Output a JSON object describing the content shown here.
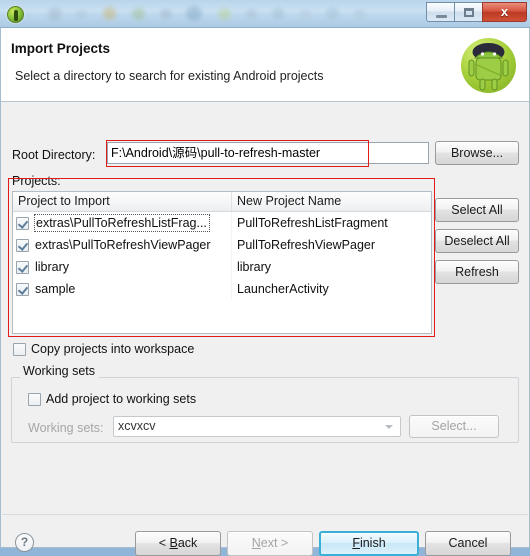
{
  "window": {
    "app_icon": "android-eclipse-icon",
    "controls": {
      "minimize_label": "",
      "maximize_label": "",
      "close_label": "x"
    }
  },
  "header": {
    "title": "Import Projects",
    "description": "Select a directory to search for existing Android projects",
    "logo": "android-robot-icon"
  },
  "root_directory": {
    "label": "Root Directory:",
    "value": "F:\\Android\\源码\\pull-to-refresh-master",
    "placeholder": "",
    "browse_label": "Browse..."
  },
  "projects": {
    "group_label": "Projects:",
    "columns": [
      "Project to Import",
      "New Project Name"
    ],
    "rows": [
      {
        "checked": true,
        "focused": true,
        "project_to_import": "extras\\PullToRefreshListFrag...",
        "new_project_name": "PullToRefreshListFragment"
      },
      {
        "checked": true,
        "focused": false,
        "project_to_import": "extras\\PullToRefreshViewPager",
        "new_project_name": "PullToRefreshViewPager"
      },
      {
        "checked": true,
        "focused": false,
        "project_to_import": "library",
        "new_project_name": "library"
      },
      {
        "checked": true,
        "focused": false,
        "project_to_import": "sample",
        "new_project_name": "LauncherActivity"
      }
    ],
    "buttons": {
      "select_all": "Select All",
      "deselect_all": "Deselect All",
      "refresh": "Refresh"
    }
  },
  "options": {
    "copy_projects_label": "Copy projects into workspace",
    "copy_projects_checked": false
  },
  "working_sets": {
    "group_title": "Working sets",
    "add_project_label": "Add project to working sets",
    "add_project_checked": false,
    "combo_label": "Working sets:",
    "combo_value": "xcvxcv",
    "combo_options": [
      "xcvxcv"
    ],
    "select_label": "Select...",
    "disabled": true
  },
  "footer": {
    "help_label": "?",
    "back_label": "< Back",
    "next_label": "Next >",
    "finish_label": "Finish",
    "cancel_label": "Cancel",
    "next_disabled": true,
    "default_button": "Finish"
  },
  "annotations": {
    "color": "#e01b1b",
    "boxes": [
      "root-directory-field",
      "projects-table"
    ]
  }
}
